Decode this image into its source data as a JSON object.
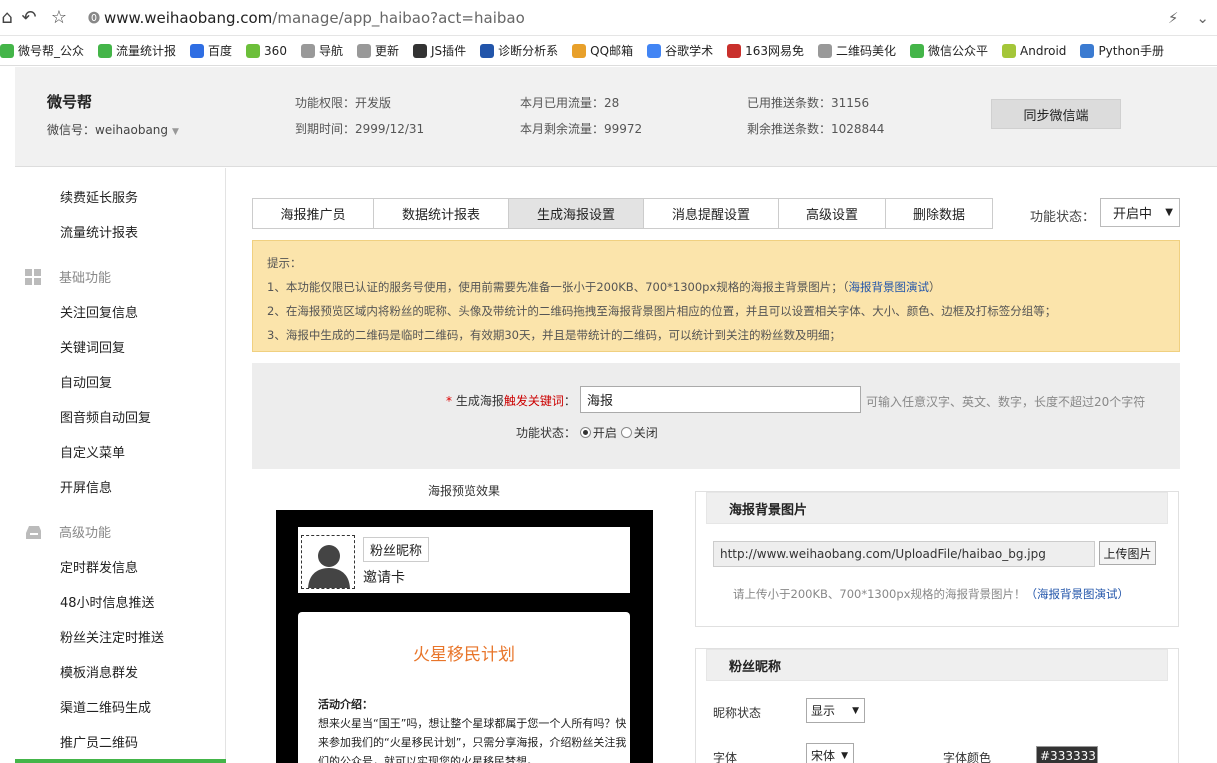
{
  "browser": {
    "url_prefix": "www.weihaobang.com",
    "url_path": "/manage/app_haibao?act=haibao",
    "bookmarks": [
      {
        "label": "微号帮_公众",
        "color": "#44b549"
      },
      {
        "label": "流量统计报",
        "color": "#44b549"
      },
      {
        "label": "百度",
        "color": "#2f6ee3"
      },
      {
        "label": "360",
        "color": "#6cbf3a"
      },
      {
        "label": "导航",
        "color": "#999999"
      },
      {
        "label": "更新",
        "color": "#999999"
      },
      {
        "label": "JS插件",
        "color": "#333333"
      },
      {
        "label": "诊断分析系",
        "color": "#2255aa"
      },
      {
        "label": "QQ邮箱",
        "color": "#e8a02a"
      },
      {
        "label": "谷歌学术",
        "color": "#4285f4"
      },
      {
        "label": "163网易免",
        "color": "#c9302c"
      },
      {
        "label": "二维码美化",
        "color": "#999999"
      },
      {
        "label": "微信公众平",
        "color": "#44b549"
      },
      {
        "label": "Android",
        "color": "#a4c639"
      },
      {
        "label": "Python手册",
        "color": "#3b7bd1"
      }
    ]
  },
  "header": {
    "brand": "微号帮",
    "wx_label": "微信号：weihaobang",
    "permission": "功能权限：开发版",
    "expire": "到期时间：2999/12/31",
    "used_flow": "本月已用流量：28",
    "remain_flow": "本月剩余流量：99972",
    "used_push": "已用推送条数：31156",
    "remain_push": "剩余推送条数：1028844",
    "sync_button": "同步微信端"
  },
  "sidebar": {
    "top_items": [
      "续费延长服务",
      "流量统计报表"
    ],
    "group_basic": "基础功能",
    "basic_items": [
      "关注回复信息",
      "关键词回复",
      "自动回复",
      "图音频自动回复",
      "自定义菜单",
      "开屏信息"
    ],
    "group_advanced": "高级功能",
    "advanced_items": [
      "定时群发信息",
      "48小时信息推送",
      "粉丝关注定时推送",
      "模板消息群发",
      "渠道二维码生成",
      "推广员二维码"
    ]
  },
  "tabs": [
    "海报推广员",
    "数据统计报表",
    "生成海报设置",
    "消息提醒设置",
    "高级设置",
    "删除数据"
  ],
  "status": {
    "label": "功能状态：",
    "value": "开启中"
  },
  "notice": {
    "title": "提示：",
    "line1": "1、本功能仅限已认证的服务号使用，使用前需要先准备一张小于200KB、700*1300px规格的海报主背景图片；（",
    "line1_link": "海报背景图演试",
    "line1_end": "）",
    "line2": "2、在海报预览区域内将粉丝的昵称、头像及带统计的二维码拖拽至海报背景图片相应的位置，并且可以设置相关字体、大小、颜色、边框及打标签分组等；",
    "line3": "3、海报中生成的二维码是临时二维码，有效期30天，并且是带统计的二维码，可以统计到关注的粉丝数及明细；"
  },
  "form": {
    "kw_req": "*",
    "kw_label_a": " 生成海报",
    "kw_label_b": "触发关键词",
    "kw_label_c": "：",
    "kw_value": "海报",
    "kw_hint": "可输入任意汉字、英文、数字，长度不超过20个字符",
    "state_label": "功能状态：",
    "on": "开启",
    "off": "关闭"
  },
  "preview": {
    "title": "海报预览效果",
    "nickname": "粉丝昵称",
    "invite": "邀请卡",
    "poster_title": "火星移民计划",
    "poster_sub": "活动介绍：",
    "poster_text": "想来火星当“国王”吗，想让整个星球都属于您一个人所有吗？快来参加我们的“火星移民计划”，只需分享海报，介绍粉丝关注我们的公众号，就可以实现您的火星移民梦想。"
  },
  "bg_panel": {
    "title": "海报背景图片",
    "url": "http://www.weihaobang.com/UploadFile/haibao_bg.jpg",
    "upload": "上传图片",
    "hint": "请上传小于200KB、700*1300px规格的海报背景图片！",
    "hint_link": "（海报背景图演试）"
  },
  "nick_panel": {
    "title": "粉丝昵称",
    "state_label": "昵称状态",
    "state_value": "显示",
    "font_label": "字体",
    "font_value": "宋体",
    "color_label": "字体颜色",
    "color_value": "#333333"
  }
}
